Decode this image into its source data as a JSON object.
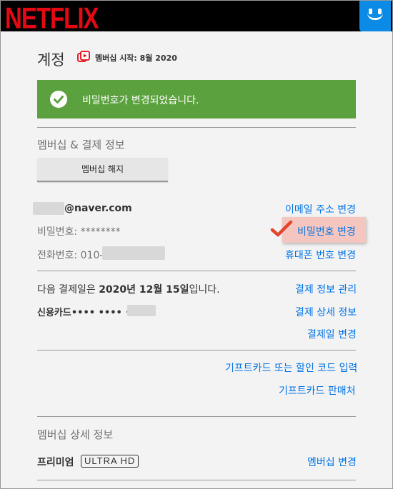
{
  "header": {
    "logo_text": "NETFLIX",
    "avatar_icon": "smiley-face-icon"
  },
  "account": {
    "title": "계정",
    "member_since": "멤버십 시작: 8월 2020"
  },
  "banner": {
    "message": "비밀번호가 변경되었습니다.",
    "icon": "check-circle-icon"
  },
  "membership_billing": {
    "heading": "멤버십 & 결제 정보",
    "cancel_button": "멤버십 해지",
    "email_suffix": "@naver.com",
    "password_label": "비밀번호: ********",
    "phone_label": "전화번호: 010-",
    "change_email": "이메일 주소 변경",
    "change_password": "비밀번호 변경",
    "change_phone": "휴대폰 번호 변경",
    "next_billing_prefix": "다음 결제일은 ",
    "next_billing_date": "2020년 12월 15일",
    "next_billing_suffix": "입니다.",
    "card_label": "신용카드",
    "card_masked": "•••• •••• ••••",
    "manage_payment": "결제 정보 관리",
    "billing_details": "결제 상세 정보",
    "change_billing_day": "결제일 변경",
    "redeem_gift": "기프트카드 또는 할인 코드 입력",
    "gift_retailers": "기프트카드 판매처"
  },
  "plan": {
    "heading": "멤버십 상세 정보",
    "plan_name": "프리미엄",
    "badge": "ULTRA HD",
    "change_plan": "멤버십 변경"
  },
  "colors": {
    "brand_red": "#e50914",
    "success_green": "#5ba13e",
    "link_blue": "#0073e6",
    "avatar_blue": "#0b8be6",
    "highlight": "#f4c6bf"
  }
}
